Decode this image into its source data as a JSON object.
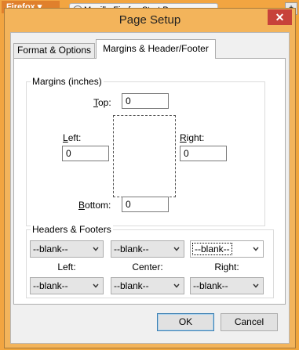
{
  "background": {
    "menu_label": "Firefox",
    "tab_title": "Mozilla Firefox Start Page"
  },
  "dialog": {
    "title": "Page Setup",
    "close_label": "✕",
    "tabs": [
      {
        "label": "Format & Options",
        "active": false
      },
      {
        "label": "Margins & Header/Footer",
        "active": true
      }
    ],
    "margins": {
      "group_label": "Margins (inches)",
      "top_label": "Top:",
      "top_value": "0",
      "left_label": "Left:",
      "left_value": "0",
      "right_label": "Right:",
      "right_value": "0",
      "bottom_label": "Bottom:",
      "bottom_value": "0"
    },
    "headers_footers": {
      "group_label": "Headers & Footers",
      "header_left": "--blank--",
      "header_center": "--blank--",
      "header_right": "--blank--",
      "left_label": "Left:",
      "center_label": "Center:",
      "right_label": "Right:",
      "footer_left": "--blank--",
      "footer_center": "--blank--",
      "footer_right": "--blank--"
    },
    "ok_label": "OK",
    "cancel_label": "Cancel"
  },
  "colors": {
    "frame": "#f3b45b",
    "close_button": "#c7423a",
    "default_button_border": "#3c7fb1"
  }
}
